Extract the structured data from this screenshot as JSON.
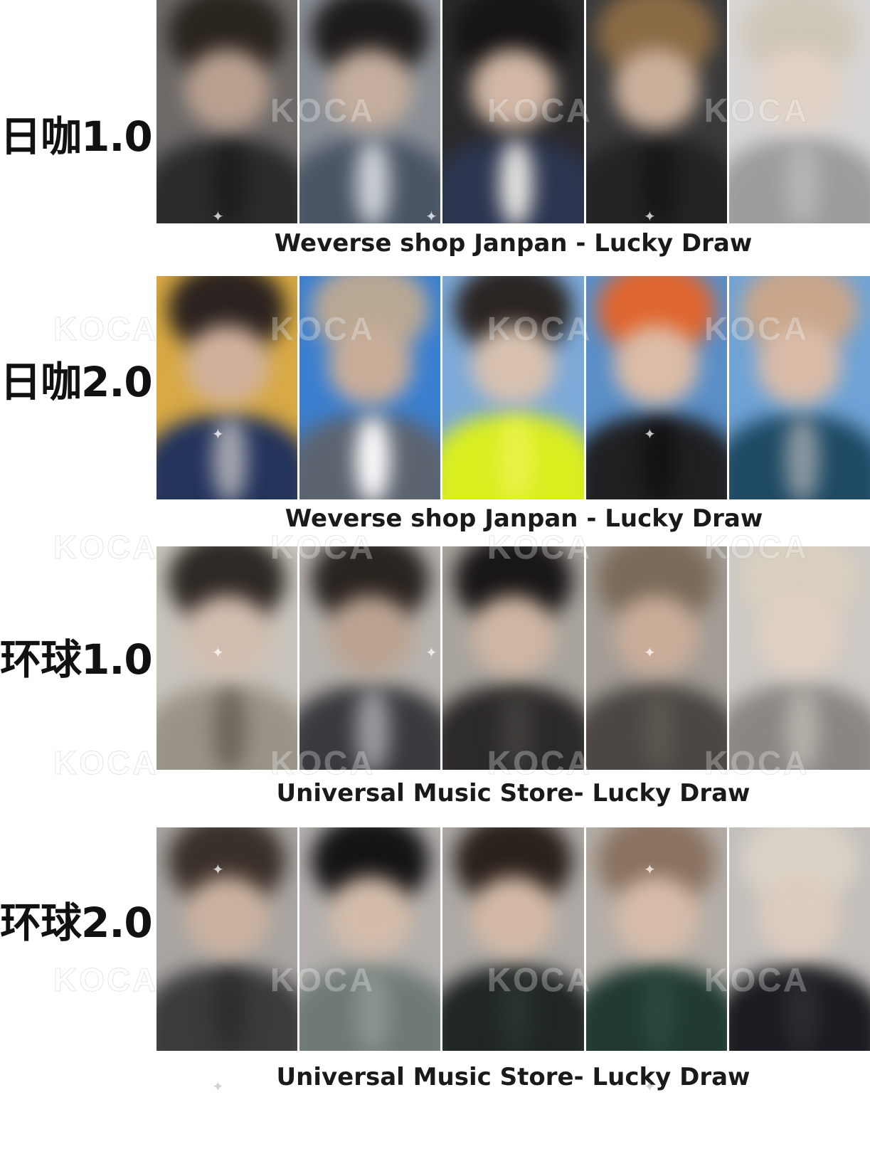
{
  "rows": [
    {
      "label": "日咖1.0",
      "caption": "Weverse shop Janpan - Lucky Draw",
      "cards": [
        {
          "hair": "#2a241f",
          "face": "#b9a08f",
          "body": "#2b2b2d",
          "bg": "#6d6a68",
          "accent": "#1d1d1f"
        },
        {
          "hair": "#1e1c1b",
          "face": "#c4ad9c",
          "body": "#4a5564",
          "bg": "#8a8f96",
          "accent": "#cfd3d8"
        },
        {
          "hair": "#161414",
          "face": "#d1b7a4",
          "body": "#2c3650",
          "bg": "#2a2a2c",
          "accent": "#e8e6e2"
        },
        {
          "hair": "#8b6b45",
          "face": "#cbb19c",
          "body": "#232325",
          "bg": "#3a3a3c",
          "accent": "#161616"
        },
        {
          "hair": "#cfc7b9",
          "face": "#e1d2c6",
          "body": "#9c9c9c",
          "bg": "#d8d6d4",
          "accent": "#b5b5b5"
        }
      ]
    },
    {
      "label": "日咖2.0",
      "caption": "Weverse shop Janpan - Lucky Draw",
      "cards": [
        {
          "hair": "#2b2320",
          "face": "#d0b19c",
          "body": "#23335c",
          "bg": "#d8a944",
          "accent": "#a7a8b0"
        },
        {
          "hair": "#b9a894",
          "face": "#c8ad98",
          "body": "#5c6470",
          "bg": "#3b7fd0",
          "accent": "#ffffff"
        },
        {
          "hair": "#2b2522",
          "face": "#d8c1af",
          "body": "#d9ee1f",
          "bg": "#7da9d8",
          "accent": "#e8f34a"
        },
        {
          "hair": "#e0662f",
          "face": "#dcbca6",
          "body": "#202022",
          "bg": "#5a8fc8",
          "accent": "#111111"
        },
        {
          "hair": "#c9a68a",
          "face": "#d9bba7",
          "body": "#1f4a64",
          "bg": "#6fa3d6",
          "accent": "#8d9aa3"
        }
      ]
    },
    {
      "label": "环球1.0",
      "caption": "Universal Music Store- Lucky Draw",
      "cards": [
        {
          "hair": "#2f2925",
          "face": "#d2bdae",
          "body": "#9a9488",
          "bg": "#c9c4bc",
          "accent": "#6c665d"
        },
        {
          "hair": "#2a2420",
          "face": "#bba391",
          "body": "#3a3a3e",
          "bg": "#b7b3ae",
          "accent": "#9c9ca0"
        },
        {
          "hair": "#191716",
          "face": "#cfb6a3",
          "body": "#2c2a28",
          "bg": "#a8a49e",
          "accent": "#403e3b"
        },
        {
          "hair": "#7a6a58",
          "face": "#c9ad99",
          "body": "#4a4642",
          "bg": "#a39d96",
          "accent": "#5c5650"
        },
        {
          "hair": "#d8cfbf",
          "face": "#e0d0c2",
          "body": "#8a8682",
          "bg": "#cdc9c4",
          "accent": "#b4b0aa"
        }
      ]
    },
    {
      "label": "环球2.0",
      "caption": "Universal Music Store- Lucky Draw",
      "cards": [
        {
          "hair": "#3a302a",
          "face": "#cbb2a0",
          "body": "#3b3b3d",
          "bg": "#a9a5a1",
          "accent": "#2e2e30"
        },
        {
          "hair": "#151414",
          "face": "#d2bba9",
          "body": "#6f7a74",
          "bg": "#b3b0ad",
          "accent": "#8a958f"
        },
        {
          "hair": "#2a211c",
          "face": "#d3b9a5",
          "body": "#1f2624",
          "bg": "#aeaaa6",
          "accent": "#2b3330"
        },
        {
          "hair": "#8a7260",
          "face": "#d6bca8",
          "body": "#203a30",
          "bg": "#b4aea8",
          "accent": "#2a4a3d"
        },
        {
          "hair": "#d9d2c6",
          "face": "#dccbbe",
          "body": "#1c1c20",
          "bg": "#c2bfbb",
          "accent": "#2b2b30"
        }
      ]
    }
  ],
  "watermark": "KOCA"
}
